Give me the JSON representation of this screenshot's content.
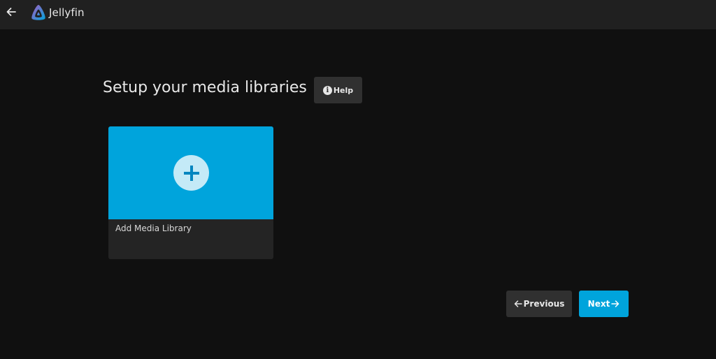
{
  "header": {
    "back_icon": "arrow-left-icon",
    "logo_icon": "jellyfin-logo",
    "brand": "Jellyfin"
  },
  "main": {
    "title": "Setup your media libraries",
    "help_label": "Help",
    "help_icon": "info-icon",
    "add_library_card": {
      "label": "Add Media Library",
      "icon": "plus-icon",
      "accent": "#00a4dc"
    }
  },
  "footer": {
    "previous_label": "Previous",
    "previous_icon": "arrow-left-icon",
    "next_label": "Next",
    "next_icon": "arrow-right-icon"
  },
  "colors": {
    "background": "#101010",
    "header": "#202020",
    "accent": "#00a4dc",
    "button": "#303030"
  }
}
